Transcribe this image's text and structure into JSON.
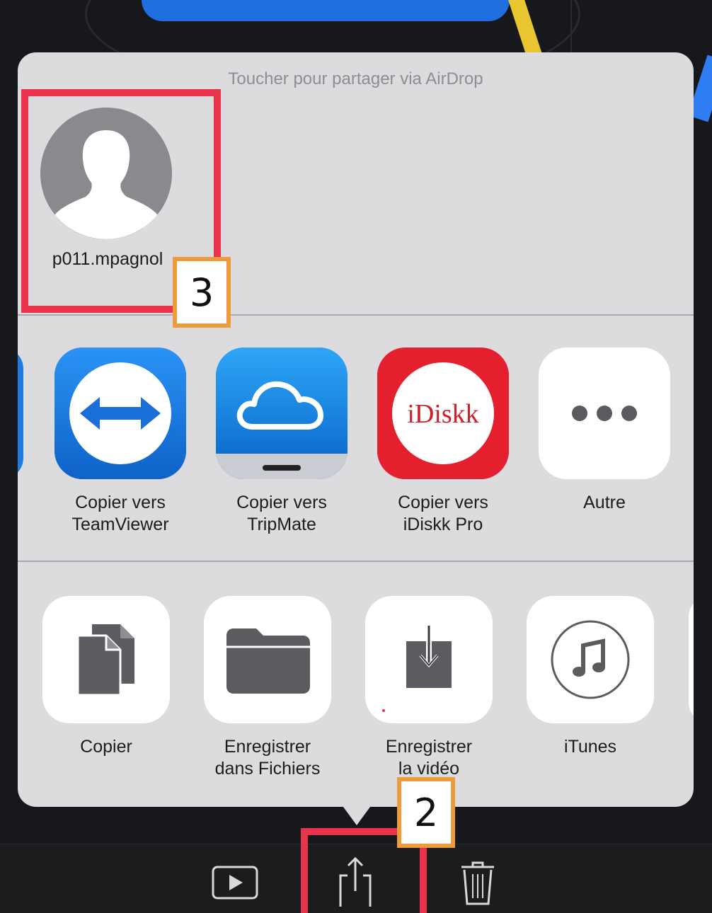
{
  "airdrop": {
    "title": "Toucher pour partager via AirDrop",
    "contact_name": "p011.mpagnol",
    "contact_icon": "person-silhouette-icon"
  },
  "apps": [
    {
      "line1": "Copier vers",
      "line2": "TeamViewer",
      "icon": "teamviewer-icon",
      "color": "#1b7ce8"
    },
    {
      "line1": "Copier vers",
      "line2": "TripMate",
      "icon": "tripmate-icon",
      "color": "#1f8fe8"
    },
    {
      "line1": "Copier vers",
      "line2": "iDiskk Pro",
      "icon": "idiskk-icon",
      "color": "#e5202e",
      "icon_text": "iDiskk"
    },
    {
      "line1": "Autre",
      "line2": "",
      "icon": "more-icon",
      "color": "#ffffff"
    }
  ],
  "actions": [
    {
      "line1": "Copier",
      "line2": "",
      "icon": "copy-icon"
    },
    {
      "line1": "Enregistrer",
      "line2": "dans Fichiers",
      "icon": "folder-icon"
    },
    {
      "line1": "Enregistrer",
      "line2": "la vidéo",
      "icon": "save-video-icon"
    },
    {
      "line1": "iTunes",
      "line2": "",
      "icon": "itunes-icon"
    }
  ],
  "toolbar": {
    "play_icon": "play-icon",
    "share_icon": "share-icon",
    "trash_icon": "trash-icon"
  },
  "annotations": {
    "badge_share": "2",
    "badge_contact": "3",
    "highlight_color": "#e8334a",
    "badge_border_color": "#ef9a3b"
  }
}
